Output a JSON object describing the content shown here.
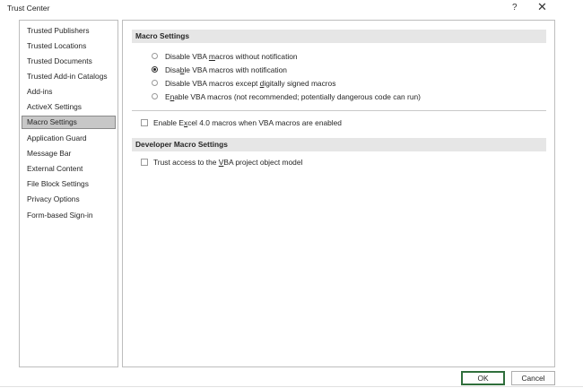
{
  "window": {
    "title": "Trust Center",
    "help_label": "?",
    "close_label": "✕"
  },
  "sidebar": {
    "items": [
      {
        "label": "Trusted Publishers",
        "selected": false
      },
      {
        "label": "Trusted Locations",
        "selected": false
      },
      {
        "label": "Trusted Documents",
        "selected": false
      },
      {
        "label": "Trusted Add-in Catalogs",
        "selected": false
      },
      {
        "label": "Add-ins",
        "selected": false
      },
      {
        "label": "ActiveX Settings",
        "selected": false
      },
      {
        "label": "Macro Settings",
        "selected": true
      },
      {
        "label": "Application Guard",
        "selected": false
      },
      {
        "label": "Message Bar",
        "selected": false
      },
      {
        "label": "External Content",
        "selected": false
      },
      {
        "label": "File Block Settings",
        "selected": false
      },
      {
        "label": "Privacy Options",
        "selected": false
      },
      {
        "label": "Form-based Sign-in",
        "selected": false
      }
    ]
  },
  "macro_settings": {
    "header": "Macro Settings",
    "options": [
      {
        "pre": "Disable VBA ",
        "key": "m",
        "post": "acros without notification",
        "checked": false
      },
      {
        "pre": "Disa",
        "key": "b",
        "post": "le VBA macros with notification",
        "checked": true
      },
      {
        "pre": "Disable VBA macros except ",
        "key": "d",
        "post": "igitally signed macros",
        "checked": false
      },
      {
        "pre": "E",
        "key": "n",
        "post": "able VBA macros (not recommended; potentially dangerous code can run)",
        "checked": false
      }
    ],
    "excel4": {
      "pre": "Enable E",
      "key": "x",
      "post": "cel 4.0 macros when VBA macros are enabled",
      "checked": false
    }
  },
  "developer_settings": {
    "header": "Developer Macro Settings",
    "trust_vba": {
      "pre": "Trust access to the ",
      "key": "V",
      "post": "BA project object model",
      "checked": false
    }
  },
  "buttons": {
    "ok": "OK",
    "cancel": "Cancel"
  }
}
